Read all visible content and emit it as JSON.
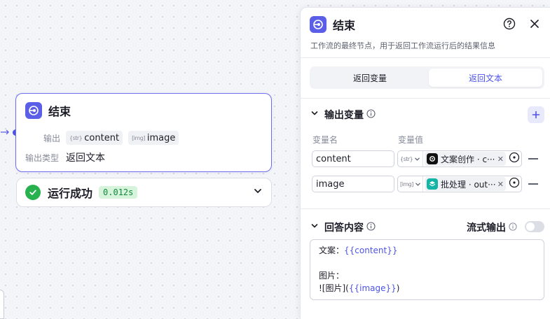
{
  "node": {
    "title": "结束",
    "output_label": "输出",
    "output_tags": [
      {
        "type_label": "{str}",
        "name": "content"
      },
      {
        "type_label": "[img]",
        "name": "image"
      }
    ],
    "output_type_label": "输出类型",
    "output_type_value": "返回文本",
    "status_text": "运行成功",
    "status_time": "0.012s"
  },
  "panel": {
    "title": "结束",
    "description": "工作流的最终节点，用于返回工作流运行后的结果信息",
    "tabs": [
      {
        "label": "返回变量",
        "active": false
      },
      {
        "label": "返回文本",
        "active": true
      }
    ],
    "output_section": {
      "title": "输出变量",
      "col_name": "变量名",
      "col_value": "变量值",
      "rows": [
        {
          "name": "content",
          "type_label": "{str}",
          "ref_text": "文案创作 · c···",
          "ref_icon": "ai-logo-icon",
          "ref_color": "#111111"
        },
        {
          "name": "image",
          "type_label": "[img]",
          "ref_text": "批处理 · out···",
          "ref_icon": "layers-icon",
          "ref_color": "#12b5a5"
        }
      ]
    },
    "answer_section": {
      "title": "回答内容",
      "stream_label": "流式输出",
      "stream_on": false,
      "line1_prefix": "文案：",
      "line1_var": "{{content}}",
      "line3": "图片：",
      "line4_prefix": "![图片](",
      "line4_var": "{{image}}",
      "line4_suffix": ")"
    }
  },
  "colors": {
    "accent": "#4d53e8",
    "success": "#27b24f",
    "node_border": "#6b6ff0"
  }
}
